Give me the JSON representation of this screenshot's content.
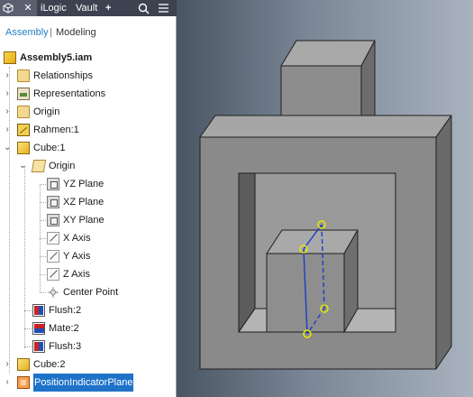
{
  "browser": {
    "tabs": {
      "home_icon": "cube-icon",
      "close_label": "✕",
      "ilogic_label": "iLogic",
      "vault_label": "Vault",
      "add_label": "+",
      "search_icon": "search-icon",
      "menu_icon": "hamburger-icon"
    },
    "view": {
      "assembly": "Assembly",
      "separator": "|",
      "modeling": "Modeling"
    },
    "tree": [
      {
        "label": "Assembly5.iam",
        "icon": "assembly-icon",
        "bold": true
      },
      {
        "label": "Relationships",
        "icon": "folder-icon"
      },
      {
        "label": "Representations",
        "icon": "representations-icon"
      },
      {
        "label": "Origin",
        "icon": "folder-icon"
      },
      {
        "label": "Rahmen:1",
        "icon": "weldment-part-icon"
      },
      {
        "label": "Cube:1",
        "icon": "part-icon"
      },
      {
        "label": "Origin",
        "icon": "folder-open-icon"
      },
      {
        "label": "YZ Plane",
        "icon": "plane-icon"
      },
      {
        "label": "XZ Plane",
        "icon": "plane-icon"
      },
      {
        "label": "XY Plane",
        "icon": "plane-icon"
      },
      {
        "label": "X Axis",
        "icon": "axis-icon"
      },
      {
        "label": "Y Axis",
        "icon": "axis-icon"
      },
      {
        "label": "Z Axis",
        "icon": "axis-icon"
      },
      {
        "label": "Center Point",
        "icon": "center-point-icon"
      },
      {
        "label": "Flush:2",
        "icon": "flush-constraint-icon"
      },
      {
        "label": "Mate:2",
        "icon": "mate-constraint-icon"
      },
      {
        "label": "Flush:3",
        "icon": "flush-constraint-icon"
      },
      {
        "label": "Cube:2",
        "icon": "part-icon"
      },
      {
        "label": "PositionIndicatorPlane",
        "icon": "position-plane-icon",
        "selected": true
      }
    ]
  },
  "viewport": {
    "background": [
      "#4a5564",
      "#a9b3bf"
    ],
    "model_face_color": "#8c8c8c",
    "model_edge_color": "#1e1e1e",
    "constraint_line_color": "#1a3ec8",
    "grip_color": "#e8e800"
  },
  "colors": {
    "accent": "#1d7fc4",
    "selection": "#1e73c9",
    "tabbar": "#3c4250"
  }
}
